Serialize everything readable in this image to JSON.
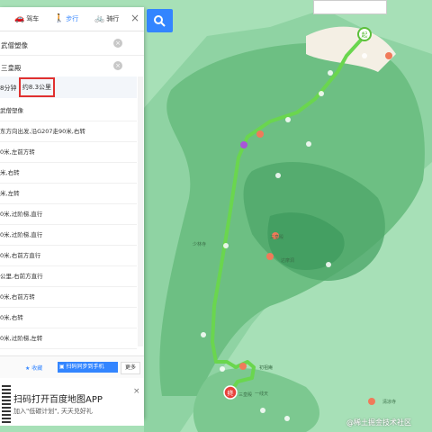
{
  "modes": [
    {
      "label": "驾车",
      "icon": "car-icon"
    },
    {
      "label": "步行",
      "icon": "walk-icon"
    },
    {
      "label": "骑行",
      "icon": "bike-icon"
    }
  ],
  "active_mode": "步行",
  "close_label": "×",
  "start_value": "武僧塑像",
  "end_value": "三皇殿",
  "clear_label": "×",
  "summary": {
    "time": "8分钟",
    "distance": "约8.3公里"
  },
  "route_start": "武僧塑像",
  "steps": [
    "东方向出发,沿G207走90米,右转",
    "0米,左前方转",
    "米,右转",
    "米,左转",
    "0米,过阶梯,直行",
    "0米,过阶梯,直行",
    "0米,右前方直行",
    "公里,右前方直行",
    "0米,右前方转",
    "0米,右转",
    "0米,过阶梯,左转",
    "公里,右前方转"
  ],
  "bottom": {
    "collect": "收藏",
    "send_phone": "扫码同步到手机",
    "more": "更多"
  },
  "promo": {
    "title": "扫码打开百度地图APP",
    "subtitle": "加入\"低碳计划\", 天天兑好礼",
    "close": "×"
  },
  "map": {
    "start_marker": "起",
    "end_marker": "终",
    "route_color": "#6ad64e",
    "labels": [
      "三皇殿",
      "三皇殿",
      "一线天",
      "达摩洞",
      "初祖庵",
      "清凉寺",
      "少林寺"
    ]
  },
  "credit": "@稀土掘金技术社区"
}
